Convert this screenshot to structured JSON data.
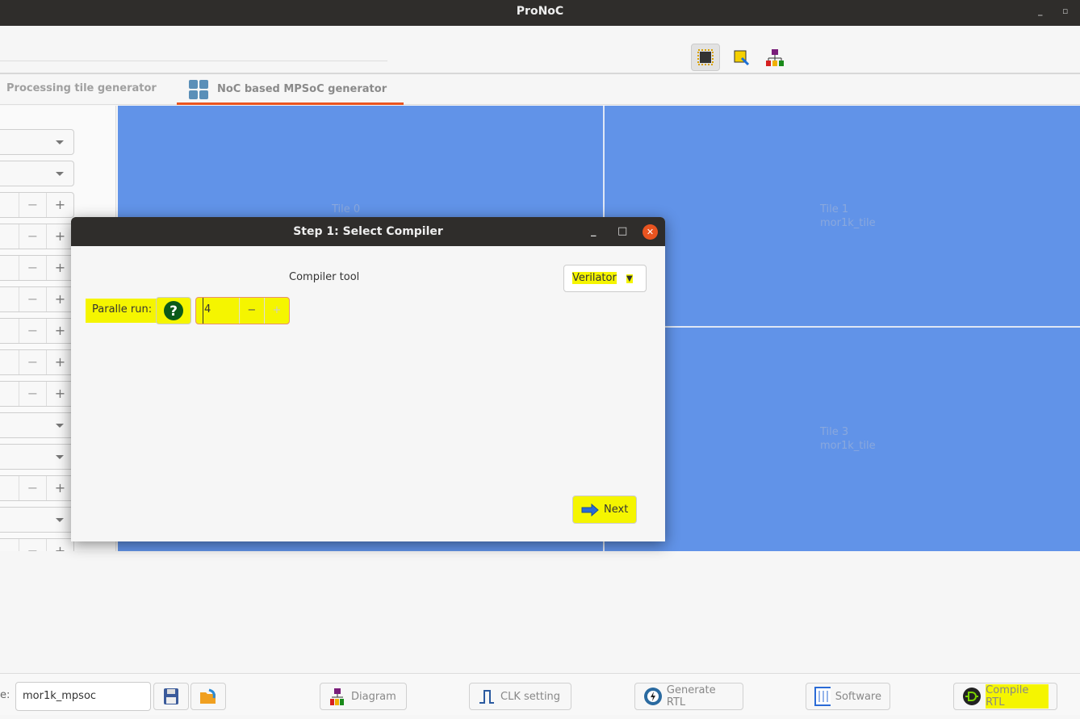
{
  "window": {
    "title": "ProNoC"
  },
  "toolbar": {
    "icons": [
      "cpu-icon",
      "tile-edit-icon",
      "hierarchy-icon"
    ]
  },
  "tabs": [
    {
      "label": "Processing tile generator",
      "active": false
    },
    {
      "label": "NoC based MPSoC generator",
      "active": true
    }
  ],
  "canvas": {
    "color": "#6193e8",
    "tiles": [
      {
        "name": "Tile 0",
        "type": ""
      },
      {
        "name": "Tile 1",
        "type": "mor1k_tile"
      },
      {
        "name": "Tile 3",
        "type": "mor1k_tile"
      }
    ]
  },
  "dialog": {
    "title": "Step 1: Select Compiler",
    "compiler_label": "Compiler tool",
    "compiler_value": "Verilator",
    "parallel_label": "Paralle run:",
    "parallel_value": "4",
    "minus": "−",
    "plus": "+",
    "next_label": "Next"
  },
  "bottom": {
    "name_prefix": "e:",
    "name_value": "mor1k_mpsoc",
    "diagram": "Diagram",
    "clk": "CLK setting",
    "generate": "Generate RTL",
    "software": "Software",
    "compile": "Compile RTL"
  },
  "colors": {
    "accent": "#e95420",
    "highlight": "#f5f500"
  }
}
